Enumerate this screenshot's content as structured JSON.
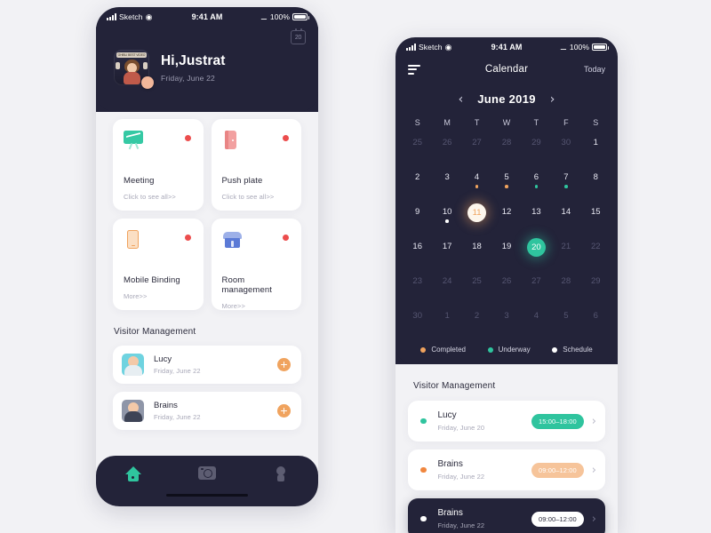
{
  "left_phone": {
    "status_bar": {
      "carrier": "Sketch",
      "time": "9:41 AM",
      "battery": "100%"
    },
    "calendar_chip": "20",
    "hero": {
      "greeting": "Hi,Justrat",
      "date": "Friday,  June 22",
      "avatar_band": "GHIBLI BEST VIDEO"
    },
    "tiles": [
      {
        "icon": "presentation-board-icon",
        "title": "Meeting",
        "subtitle": "Click to see all>>",
        "dot_color": "#ec4d4d"
      },
      {
        "icon": "door-icon",
        "title": "Push plate",
        "subtitle": "Click to see all>>",
        "dot_color": "#ec4d4d"
      },
      {
        "icon": "mobile-phone-icon",
        "title": "Mobile Binding",
        "subtitle": "More>>",
        "dot_color": "#ec4d4d"
      },
      {
        "icon": "store-icon",
        "title": "Room management",
        "subtitle": "More>>",
        "dot_color": "#ec4d4d"
      }
    ],
    "section_title": "Visitor Management",
    "visitors": [
      {
        "name": "Lucy",
        "date": "Friday,  June 22",
        "action": "add"
      },
      {
        "name": "Brains",
        "date": "Friday,  June 22",
        "action": "add"
      }
    ],
    "tabs": [
      {
        "icon": "home-icon",
        "active": true
      },
      {
        "icon": "camera-icon",
        "active": false
      },
      {
        "icon": "user-icon",
        "active": false
      }
    ]
  },
  "right_phone": {
    "status_bar": {
      "carrier": "Sketch",
      "time": "9:41 AM",
      "battery": "100%"
    },
    "header": {
      "menu_icon": "hamburger-icon",
      "title": "Calendar",
      "today": "Today"
    },
    "month": {
      "prev": "‹",
      "label": "June 2019",
      "next": "›"
    },
    "weekdays": [
      "S",
      "M",
      "T",
      "W",
      "T",
      "F",
      "S"
    ],
    "weeks": [
      [
        {
          "num": "25",
          "muted": true
        },
        {
          "num": "26",
          "muted": true
        },
        {
          "num": "27",
          "muted": true
        },
        {
          "num": "28",
          "muted": true
        },
        {
          "num": "29",
          "muted": true
        },
        {
          "num": "30",
          "muted": true
        },
        {
          "num": "1",
          "muted": false
        }
      ],
      [
        {
          "num": "2"
        },
        {
          "num": "3"
        },
        {
          "num": "4",
          "dot": "orange"
        },
        {
          "num": "5",
          "dot": "orange"
        },
        {
          "num": "6",
          "dot": "teal"
        },
        {
          "num": "7",
          "dot": "teal"
        },
        {
          "num": "8"
        }
      ],
      [
        {
          "num": "9"
        },
        {
          "num": "10",
          "dot": "white"
        },
        {
          "num": "11",
          "selected": "white"
        },
        {
          "num": "12"
        },
        {
          "num": "13"
        },
        {
          "num": "14"
        },
        {
          "num": "15"
        }
      ],
      [
        {
          "num": "16"
        },
        {
          "num": "17"
        },
        {
          "num": "18"
        },
        {
          "num": "19"
        },
        {
          "num": "20",
          "selected": "teal"
        },
        {
          "num": "21",
          "muted": true
        },
        {
          "num": "22",
          "muted": true
        }
      ],
      [
        {
          "num": "23",
          "muted": true
        },
        {
          "num": "24",
          "muted": true
        },
        {
          "num": "25",
          "muted": true
        },
        {
          "num": "26",
          "muted": true
        },
        {
          "num": "27",
          "muted": true
        },
        {
          "num": "28",
          "muted": true
        },
        {
          "num": "29",
          "muted": true
        }
      ],
      [
        {
          "num": "30",
          "muted": true
        },
        {
          "num": "1",
          "muted": true
        },
        {
          "num": "2",
          "muted": true
        },
        {
          "num": "3",
          "muted": true
        },
        {
          "num": "4",
          "muted": true
        },
        {
          "num": "5",
          "muted": true
        },
        {
          "num": "6",
          "muted": true
        }
      ]
    ],
    "legend": [
      {
        "label": "Completed",
        "color": "#f0a35e"
      },
      {
        "label": "Underway",
        "color": "#2fc49e"
      },
      {
        "label": "Schedule",
        "color": "#ffffff"
      }
    ],
    "section_title": "Visitor Management",
    "visitors": [
      {
        "name": "Lucy",
        "date": "Friday,  June 20",
        "time": "15:00–18:00",
        "status": "teal",
        "dark": false
      },
      {
        "name": "Brains",
        "date": "Friday,  June 22",
        "time": "09:00–12:00",
        "status": "orange",
        "dark": false
      },
      {
        "name": "Brains",
        "date": "Friday,  June 22",
        "time": "09:00–12:00",
        "status": "white",
        "dark": true
      }
    ]
  }
}
